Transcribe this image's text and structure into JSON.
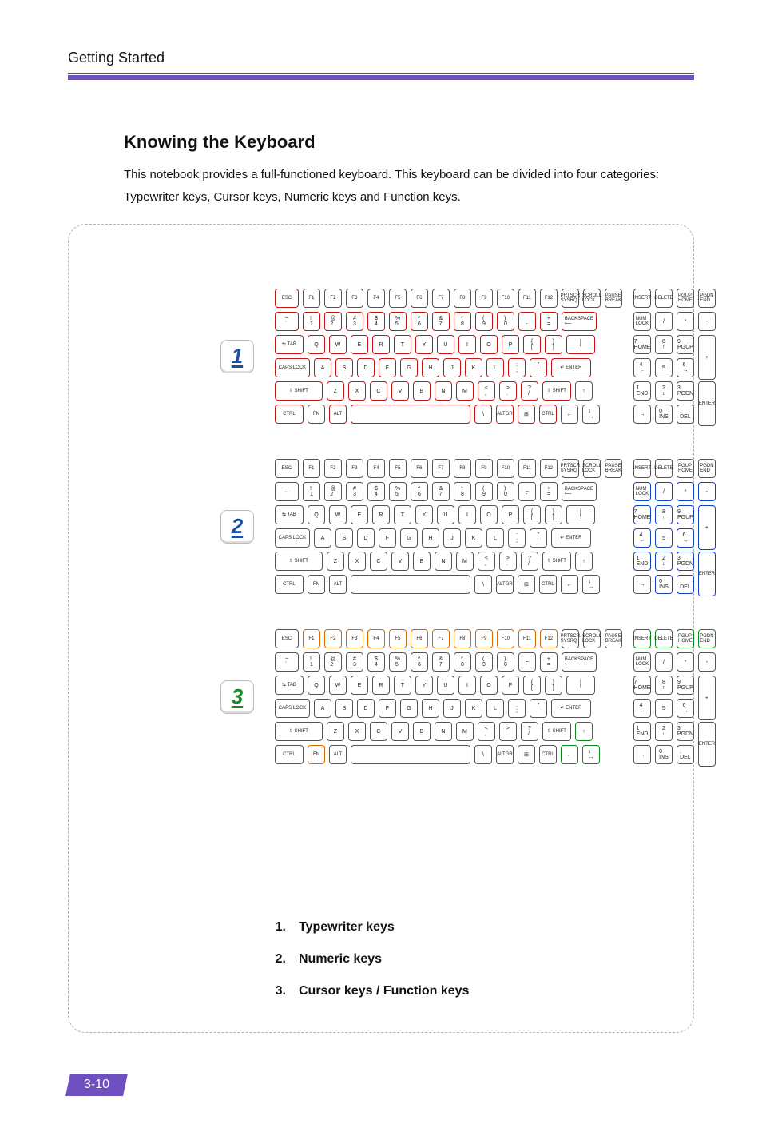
{
  "header": {
    "section_title": "Getting Started"
  },
  "intro": {
    "heading": "Knowing the Keyboard",
    "paragraph": "This notebook provides a full-functioned keyboard.    This keyboard can be divided into four categories: Typewriter keys, Cursor keys, Numeric keys and Function keys."
  },
  "callouts": [
    {
      "n": "1",
      "style": "blue"
    },
    {
      "n": "2",
      "style": "blue"
    },
    {
      "n": "3",
      "style": "green"
    }
  ],
  "legend": [
    {
      "n": "1.",
      "label": "Typewriter keys"
    },
    {
      "n": "2.",
      "label": "Numeric keys"
    },
    {
      "n": "3.",
      "label": "Cursor keys / Function keys"
    }
  ],
  "page_number": "3-10",
  "keyboard": {
    "row_fn": [
      "ESC",
      "F1",
      "F2",
      "F3",
      "F4",
      "F5",
      "F6",
      "F7",
      "F8",
      "F9",
      "F10",
      "F11",
      "F12",
      "PRTSCR\nSYSRQ",
      "SCROLL\nLOCK",
      "PAUSE\nBREAK"
    ],
    "row_fn_nav": [
      "INSERT",
      "DELETE",
      "PGUP\nHOME",
      "PGDN\nEND"
    ],
    "row_num": [
      "~\n`",
      "!\n1",
      "@\n2",
      "#\n3",
      "$\n4",
      "%\n5",
      "^\n6",
      "&\n7",
      "*\n8",
      "(\n9",
      ")\n0",
      "_\n-",
      "+\n=",
      "BACKSPACE\n⟵"
    ],
    "row_num_pad": [
      "NUM\nLOCK",
      "/",
      "*",
      "-"
    ],
    "row_q": [
      "⇆ TAB",
      "Q",
      "W",
      "E",
      "R",
      "T",
      "Y",
      "U",
      "I",
      "O",
      "P",
      "{\n[",
      "}\n]",
      "|\n\\"
    ],
    "row_q_pad": [
      "7\nHOME",
      "8\n↑",
      "9\nPGUP"
    ],
    "row_a": [
      "CAPS LOCK",
      "A",
      "S",
      "D",
      "F",
      "G",
      "H",
      "J",
      "K",
      "L",
      ":\n;",
      "\"\n'",
      "↵ ENTER"
    ],
    "row_a_pad": [
      "4\n←",
      "5",
      "6\n→"
    ],
    "row_z": [
      "⇧ SHIFT",
      "Z",
      "X",
      "C",
      "V",
      "B",
      "N",
      "M",
      "<\n,",
      ">\n.",
      "?\n/",
      "⇧ SHIFT",
      "↑"
    ],
    "row_z_pad": [
      "1\nEND",
      "2\n↓",
      "3\nPGDN"
    ],
    "row_sp": [
      "CTRL",
      "FN",
      "ALT",
      " ",
      " ",
      "\\",
      "ALTGR",
      "⊞",
      "CTRL",
      "←",
      "↓\n→"
    ],
    "row_sp_pad": [
      "→",
      "0\nINS",
      ".\nDEL"
    ],
    "numpad_tall": {
      "plus": "+",
      "enter": "ENTER"
    }
  }
}
